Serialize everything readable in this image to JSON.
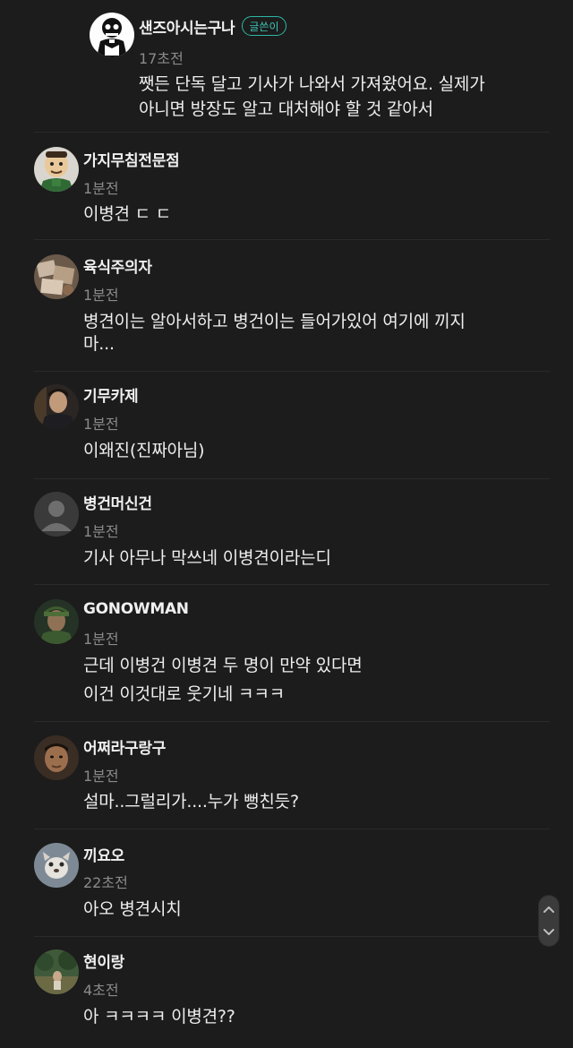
{
  "comments": [
    {
      "name": "샌즈아시는구나",
      "badge": "글쓴이",
      "time": "17초전",
      "lines": [
        "쨋든 단독 달고 기사가 나와서 가져왔어요. 실제가",
        "아니면 방장도 알고 대처해야 할 것 같아서"
      ],
      "avatar_icon": "skeleton-avatar-icon"
    },
    {
      "name": "가지무침전문점",
      "time": "1분전",
      "lines": [
        "이병견 ㄷ ㄷ"
      ],
      "avatar_icon": "cartoon-man-avatar-icon"
    },
    {
      "name": "육식주의자",
      "time": "1분전",
      "lines": [
        "병견이는 알아서하고 병건이는 들어가있어 여기에 끼지",
        "마..."
      ],
      "avatar_icon": "food-photo-avatar-icon"
    },
    {
      "name": "기무카제",
      "time": "1분전",
      "lines": [
        "이왜진(진짜아님)"
      ],
      "avatar_icon": "man-photo-avatar-icon"
    },
    {
      "name": "병건머신건",
      "time": "1분전",
      "lines": [
        "기사 아무나 막쓰네 이병견이라는디"
      ],
      "avatar_icon": "default-user-avatar-icon"
    },
    {
      "name": "GONOWMAN",
      "time": "1분전",
      "lines": [
        "근데 이병건 이병견 두 명이 만약 있다면",
        "이건 이것대로 웃기네 ㅋㅋㅋ"
      ],
      "avatar_icon": "soldier-photo-avatar-icon"
    },
    {
      "name": "어쩌라구랑구",
      "time": "1분전",
      "lines": [
        "설마..그럴리가....누가 뻥친듯?"
      ],
      "avatar_icon": "man-face-avatar-icon"
    },
    {
      "name": "끼요오",
      "time": "22초전",
      "lines": [
        "아오 병견시치"
      ],
      "avatar_icon": "animal-photo-avatar-icon"
    },
    {
      "name": "현이랑",
      "time": "4초전",
      "lines": [
        "아 ㅋㅋㅋㅋ 이병견??"
      ],
      "avatar_icon": "outdoor-photo-avatar-icon"
    }
  ],
  "scroll": {
    "up_icon": "chevron-up-icon",
    "down_icon": "chevron-down-icon"
  }
}
